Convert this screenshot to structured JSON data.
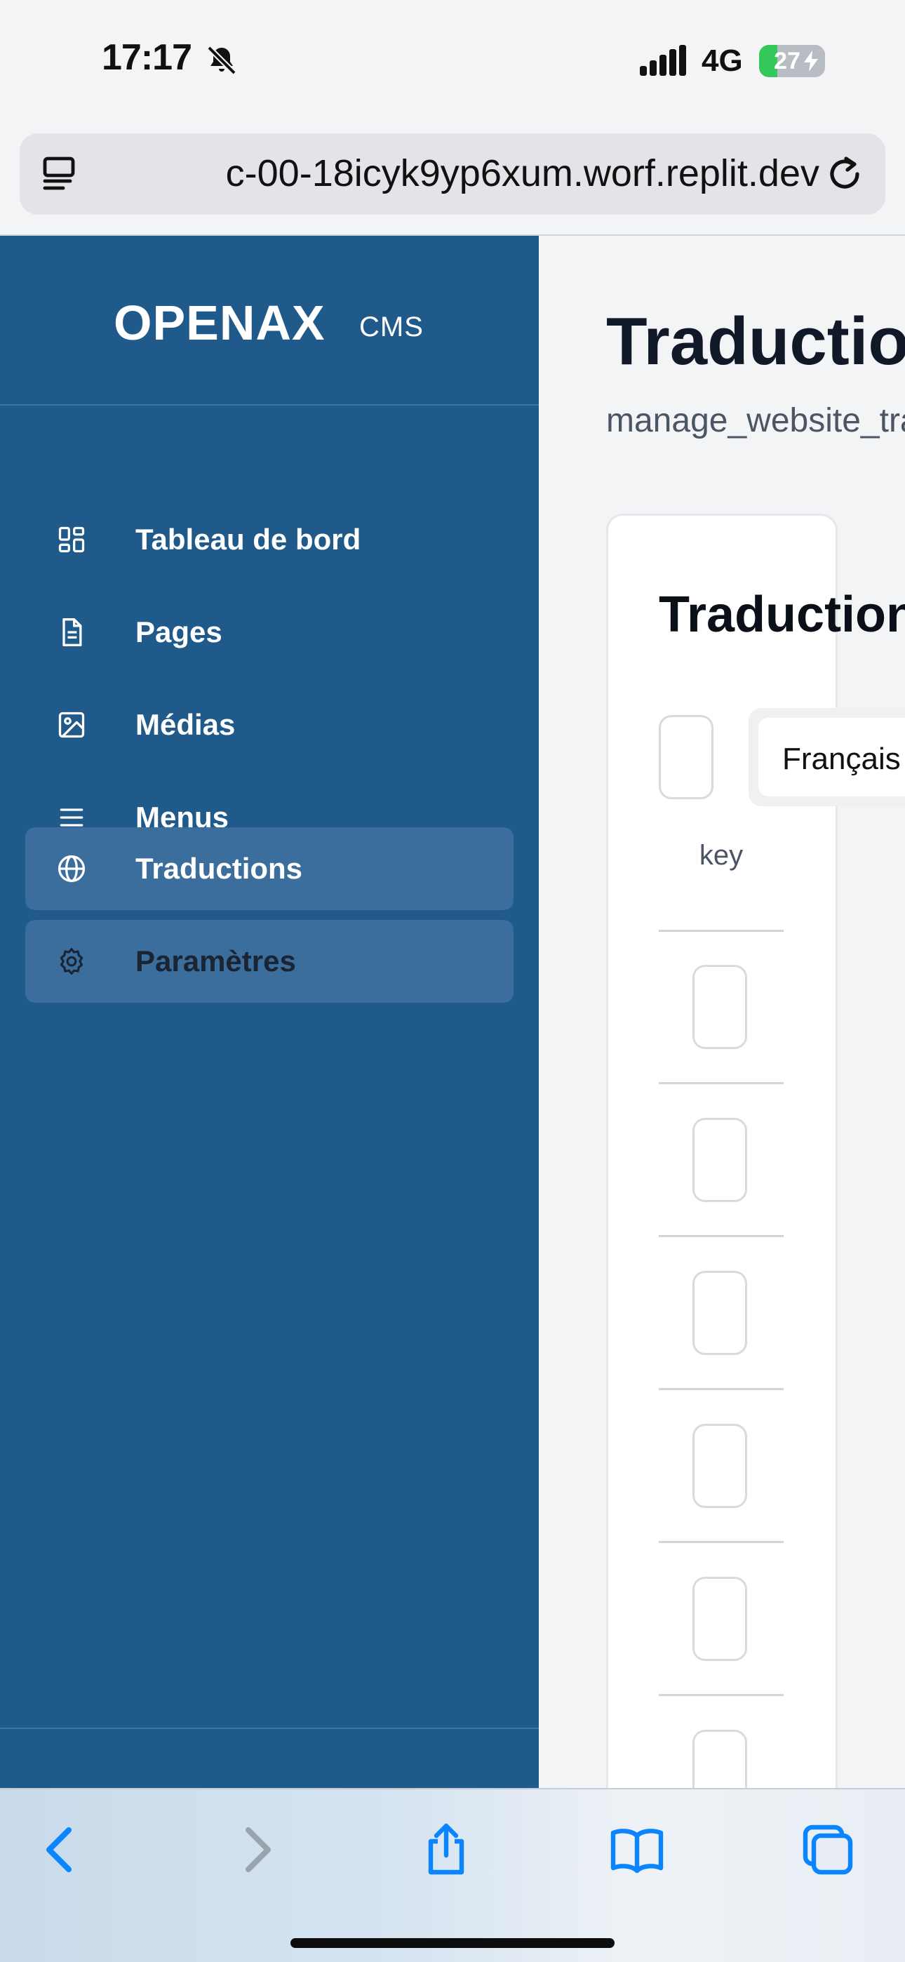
{
  "status_bar": {
    "time": "17:17",
    "network": "4G",
    "battery": "27",
    "battery_level": 0.27,
    "icons": [
      "bell-slash-icon",
      "signal-icon",
      "battery-charging-icon"
    ]
  },
  "browser": {
    "url": " c-00-18icyk9yp6xum.worf.replit.dev",
    "icons": [
      "reader-icon",
      "reload-icon"
    ]
  },
  "sidebar": {
    "brand": "OPENAX",
    "brand_sub": "CMS",
    "items": [
      {
        "label": "Tableau de bord",
        "icon": "dashboard-icon",
        "active": false
      },
      {
        "label": "Pages",
        "icon": "document-icon",
        "active": false
      },
      {
        "label": "Médias",
        "icon": "image-icon",
        "active": false
      },
      {
        "label": "Menus",
        "icon": "menu-icon",
        "active": false
      },
      {
        "label": "Traductions",
        "icon": "globe-icon",
        "active": true
      },
      {
        "label": "Paramètres",
        "icon": "gear-icon",
        "active": true
      }
    ]
  },
  "main": {
    "title": "Traductions",
    "subtitle": "manage_website_translations",
    "card": {
      "title": "Traductions",
      "language_select": "Français",
      "table": {
        "columns": [
          "key"
        ],
        "row_count": 6
      }
    }
  },
  "toolbar": {
    "icons": [
      "back-icon",
      "forward-icon",
      "share-icon",
      "bookmarks-icon",
      "tabs-icon"
    ]
  },
  "colors": {
    "sidebar_bg": "#1f5a8b",
    "sidebar_active": "#3b6e9c",
    "accent_blue": "#0a84ff",
    "battery_green": "#34c759"
  }
}
